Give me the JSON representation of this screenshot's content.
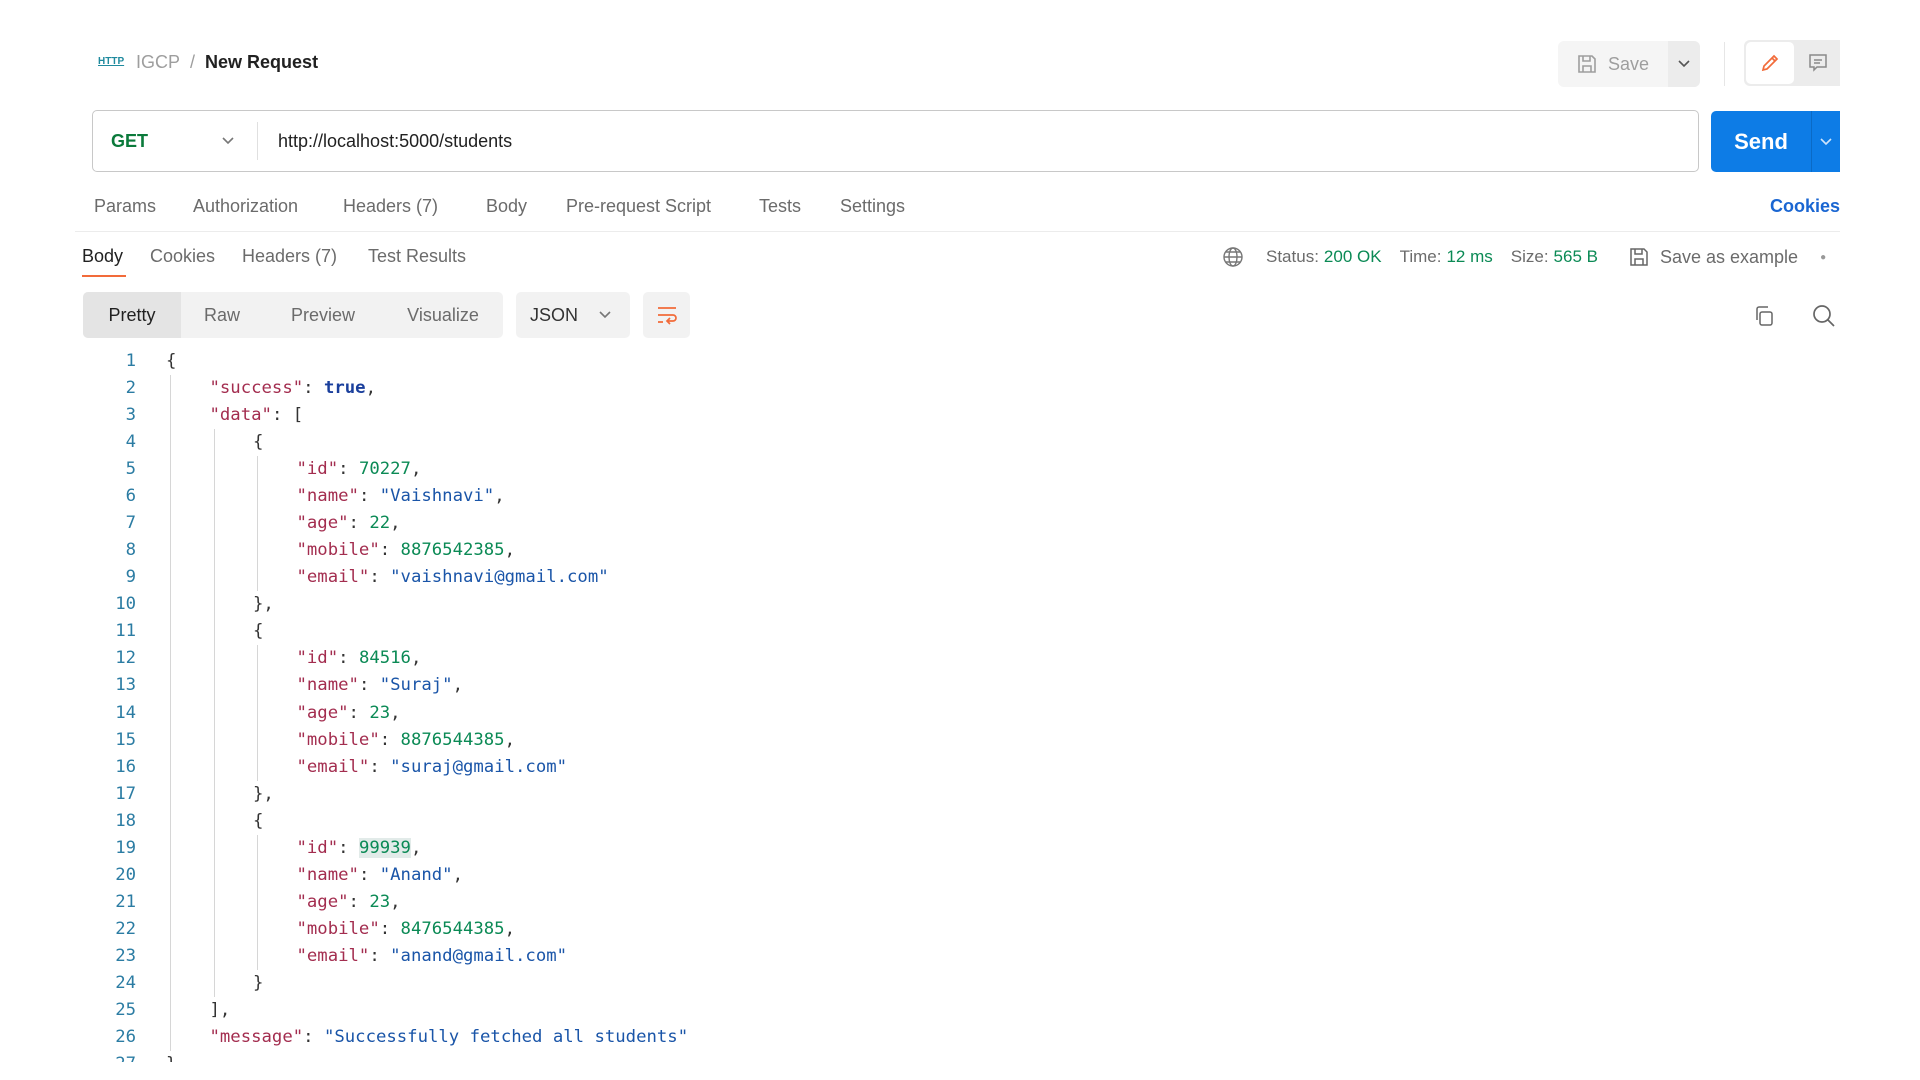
{
  "breadcrumb": {
    "icon": "http-icon",
    "icon_text": "HTTP",
    "workspace": "IGCP",
    "separator": "/",
    "current": "New Request"
  },
  "header": {
    "save_label": "Save"
  },
  "request": {
    "method": "GET",
    "url": "http://localhost:5000/students",
    "send_label": "Send"
  },
  "request_tabs": [
    "Params",
    "Authorization",
    "Headers (7)",
    "Body",
    "Pre-request Script",
    "Tests",
    "Settings"
  ],
  "cookies_link": "Cookies",
  "response_tabs": [
    "Body",
    "Cookies",
    "Headers (7)",
    "Test Results"
  ],
  "response_status": {
    "status_label": "Status:",
    "status": "200 OK",
    "time_label": "Time:",
    "time": "12 ms",
    "size_label": "Size:",
    "size": "565 B",
    "save_example": "Save as example"
  },
  "view_modes": [
    "Pretty",
    "Raw",
    "Preview",
    "Visualize"
  ],
  "format": "JSON",
  "colors": {
    "accent": "#f26b3a",
    "send": "#0d7ce6",
    "method": "#0b7a3b",
    "status_ok": "#0b8a55"
  },
  "code_lines": [
    {
      "i": 0,
      "t": [
        [
          "p",
          "{"
        ]
      ]
    },
    {
      "i": 1,
      "t": [
        [
          "k",
          "\"success\""
        ],
        [
          "p",
          ": "
        ],
        [
          "b",
          "true"
        ],
        [
          "p",
          ","
        ]
      ]
    },
    {
      "i": 1,
      "t": [
        [
          "k",
          "\"data\""
        ],
        [
          "p",
          ": ["
        ]
      ]
    },
    {
      "i": 2,
      "t": [
        [
          "p",
          "{"
        ]
      ]
    },
    {
      "i": 3,
      "t": [
        [
          "k",
          "\"id\""
        ],
        [
          "p",
          ": "
        ],
        [
          "n",
          "70227"
        ],
        [
          "p",
          ","
        ]
      ]
    },
    {
      "i": 3,
      "t": [
        [
          "k",
          "\"name\""
        ],
        [
          "p",
          ": "
        ],
        [
          "s",
          "\"Vaishnavi\""
        ],
        [
          "p",
          ","
        ]
      ]
    },
    {
      "i": 3,
      "t": [
        [
          "k",
          "\"age\""
        ],
        [
          "p",
          ": "
        ],
        [
          "n",
          "22"
        ],
        [
          "p",
          ","
        ]
      ]
    },
    {
      "i": 3,
      "t": [
        [
          "k",
          "\"mobile\""
        ],
        [
          "p",
          ": "
        ],
        [
          "n",
          "8876542385"
        ],
        [
          "p",
          ","
        ]
      ]
    },
    {
      "i": 3,
      "t": [
        [
          "k",
          "\"email\""
        ],
        [
          "p",
          ": "
        ],
        [
          "s",
          "\"vaishnavi@gmail.com\""
        ]
      ]
    },
    {
      "i": 2,
      "t": [
        [
          "p",
          "},"
        ]
      ]
    },
    {
      "i": 2,
      "t": [
        [
          "p",
          "{"
        ]
      ]
    },
    {
      "i": 3,
      "t": [
        [
          "k",
          "\"id\""
        ],
        [
          "p",
          ": "
        ],
        [
          "n",
          "84516"
        ],
        [
          "p",
          ","
        ]
      ]
    },
    {
      "i": 3,
      "t": [
        [
          "k",
          "\"name\""
        ],
        [
          "p",
          ": "
        ],
        [
          "s",
          "\"Suraj\""
        ],
        [
          "p",
          ","
        ]
      ]
    },
    {
      "i": 3,
      "t": [
        [
          "k",
          "\"age\""
        ],
        [
          "p",
          ": "
        ],
        [
          "n",
          "23"
        ],
        [
          "p",
          ","
        ]
      ]
    },
    {
      "i": 3,
      "t": [
        [
          "k",
          "\"mobile\""
        ],
        [
          "p",
          ": "
        ],
        [
          "n",
          "8876544385"
        ],
        [
          "p",
          ","
        ]
      ]
    },
    {
      "i": 3,
      "t": [
        [
          "k",
          "\"email\""
        ],
        [
          "p",
          ": "
        ],
        [
          "s",
          "\"suraj@gmail.com\""
        ]
      ]
    },
    {
      "i": 2,
      "t": [
        [
          "p",
          "},"
        ]
      ]
    },
    {
      "i": 2,
      "t": [
        [
          "p",
          "{"
        ]
      ]
    },
    {
      "i": 3,
      "t": [
        [
          "k",
          "\"id\""
        ],
        [
          "p",
          ": "
        ],
        [
          "n hl",
          "99939"
        ],
        [
          "p",
          ","
        ]
      ]
    },
    {
      "i": 3,
      "t": [
        [
          "k",
          "\"name\""
        ],
        [
          "p",
          ": "
        ],
        [
          "s",
          "\"Anand\""
        ],
        [
          "p",
          ","
        ]
      ]
    },
    {
      "i": 3,
      "t": [
        [
          "k",
          "\"age\""
        ],
        [
          "p",
          ": "
        ],
        [
          "n",
          "23"
        ],
        [
          "p",
          ","
        ]
      ]
    },
    {
      "i": 3,
      "t": [
        [
          "k",
          "\"mobile\""
        ],
        [
          "p",
          ": "
        ],
        [
          "n",
          "8476544385"
        ],
        [
          "p",
          ","
        ]
      ]
    },
    {
      "i": 3,
      "t": [
        [
          "k",
          "\"email\""
        ],
        [
          "p",
          ": "
        ],
        [
          "s",
          "\"anand@gmail.com\""
        ]
      ]
    },
    {
      "i": 2,
      "t": [
        [
          "p",
          "}"
        ]
      ]
    },
    {
      "i": 1,
      "t": [
        [
          "p",
          "],"
        ]
      ]
    },
    {
      "i": 1,
      "t": [
        [
          "k",
          "\"message\""
        ],
        [
          "p",
          ": "
        ],
        [
          "s",
          "\"Successfully fetched all students\""
        ]
      ]
    },
    {
      "i": 0,
      "t": [
        [
          "p",
          "}"
        ]
      ]
    }
  ]
}
